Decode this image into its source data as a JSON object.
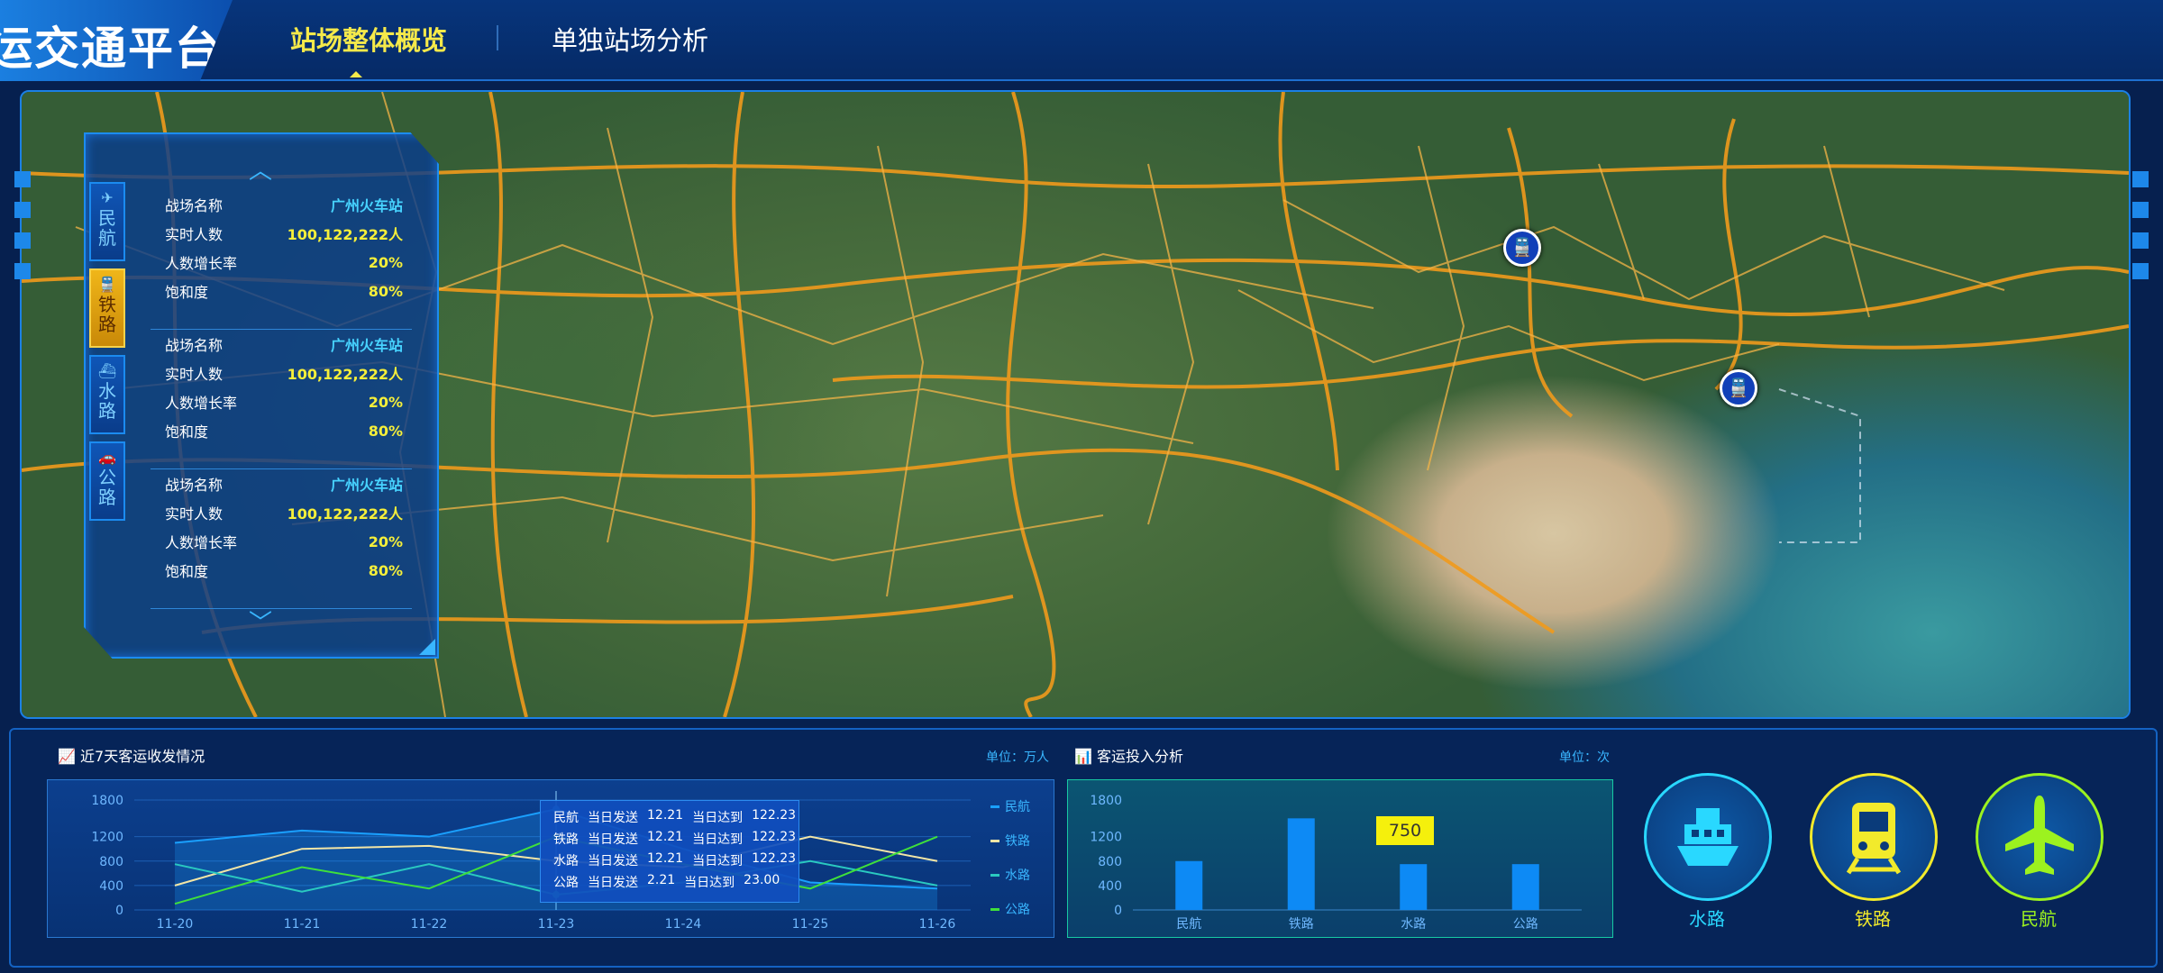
{
  "header": {
    "title": "运交通平台",
    "tabs": [
      {
        "label": "站场整体概览",
        "active": true
      },
      {
        "label": "单独站场分析",
        "active": false
      }
    ]
  },
  "map": {
    "pins": [
      {
        "icon": "train-icon",
        "type": "铁路"
      },
      {
        "icon": "train-icon",
        "type": "铁路"
      }
    ]
  },
  "station_panel": {
    "categories": [
      {
        "label": "民航",
        "icon": "airplane-icon",
        "active": false
      },
      {
        "label": "铁路",
        "icon": "train-icon",
        "active": true
      },
      {
        "label": "水路",
        "icon": "ship-icon",
        "active": false
      },
      {
        "label": "公路",
        "icon": "car-icon",
        "active": false
      }
    ],
    "field_labels": {
      "name": "战场名称",
      "count": "实时人数",
      "growth": "人数增长率",
      "saturation": "饱和度"
    },
    "cards": [
      {
        "name": "广州火车站",
        "count": "100,122,222人",
        "growth": "20%",
        "saturation": "80%"
      },
      {
        "name": "广州火车站",
        "count": "100,122,222人",
        "growth": "20%",
        "saturation": "80%"
      },
      {
        "name": "广州火车站",
        "count": "100,122,222人",
        "growth": "20%",
        "saturation": "80%"
      }
    ]
  },
  "line_panel": {
    "title": "近7天客运收发情况",
    "unit": "单位：万人",
    "tooltip": [
      {
        "mode": "民航",
        "send_label": "当日发送",
        "send": "12.21",
        "arrive_label": "当日达到",
        "arrive": "122.23"
      },
      {
        "mode": "铁路",
        "send_label": "当日发送",
        "send": "12.21",
        "arrive_label": "当日达到",
        "arrive": "122.23"
      },
      {
        "mode": "水路",
        "send_label": "当日发送",
        "send": "12.21",
        "arrive_label": "当日达到",
        "arrive": "122.23"
      },
      {
        "mode": "公路",
        "send_label": "当日发送",
        "send": "2.21",
        "arrive_label": "当日达到",
        "arrive": "23.00"
      }
    ]
  },
  "bar_panel": {
    "title": "客运投入分析",
    "unit": "单位：次",
    "highlight_label": "750"
  },
  "transport_modes": [
    {
      "label": "水路",
      "icon": "ship-icon",
      "color": "#29d8ff"
    },
    {
      "label": "铁路",
      "icon": "train-icon",
      "color": "#f2ea2b"
    },
    {
      "label": "民航",
      "icon": "airplane-icon",
      "color": "#9cf21f"
    }
  ],
  "chart_data": [
    {
      "type": "area",
      "categories": [
        "11-20",
        "11-21",
        "11-22",
        "11-23",
        "11-24",
        "11-25",
        "11-26"
      ],
      "ylim": [
        0,
        1800
      ],
      "yticks": [
        0,
        400,
        800,
        1200,
        1800
      ],
      "series": [
        {
          "name": "民航",
          "color": "#1aa0ff",
          "values": [
            1100,
            1300,
            1200,
            1650,
            1000,
            450,
            350
          ]
        },
        {
          "name": "铁路",
          "color": "#f3e6a6",
          "values": [
            400,
            1000,
            1050,
            800,
            700,
            1200,
            800
          ]
        },
        {
          "name": "水路",
          "color": "#2ac9c0",
          "values": [
            750,
            300,
            750,
            250,
            450,
            800,
            400
          ]
        },
        {
          "name": "公路",
          "color": "#3fe03b",
          "values": [
            100,
            700,
            350,
            1200,
            750,
            350,
            1200
          ]
        }
      ],
      "legend_position": "right",
      "highlight_index": 3
    },
    {
      "type": "bar",
      "categories": [
        "民航",
        "铁路",
        "水路",
        "公路"
      ],
      "values": [
        800,
        1500,
        750,
        750
      ],
      "ylim": [
        0,
        1800
      ],
      "yticks": [
        0,
        400,
        800,
        1200,
        1800
      ],
      "bar_color": "#0d8af5"
    }
  ]
}
